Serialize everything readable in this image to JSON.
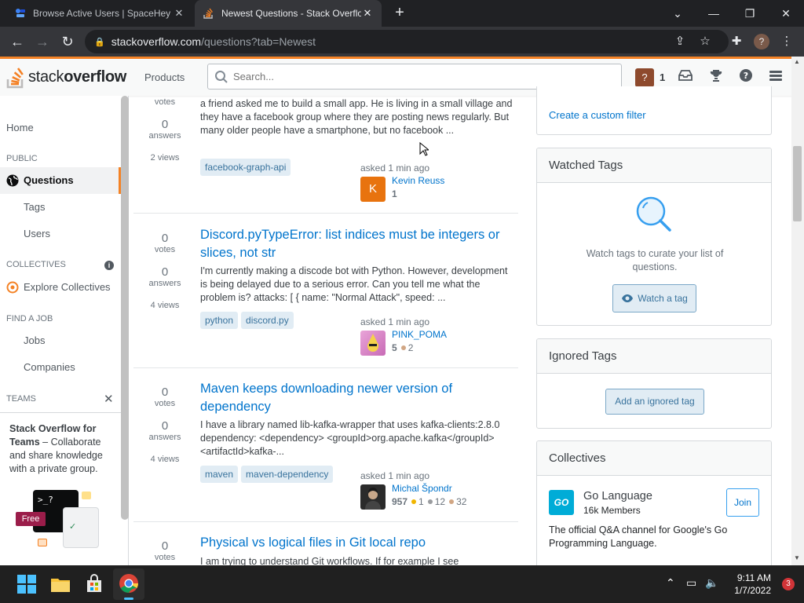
{
  "browser": {
    "tabs": [
      {
        "title": "Browse Active Users | SpaceHey",
        "active": false
      },
      {
        "title": "Newest Questions - Stack Overflow",
        "active": true
      }
    ],
    "url_host": "stackoverflow.com",
    "url_path": "/questions?tab=Newest",
    "profile_initial": "?"
  },
  "header": {
    "logo_stack": "stack",
    "logo_overflow": "overflow",
    "products": "Products",
    "search_placeholder": "Search...",
    "rep_count": "1",
    "avatar_initial": "?"
  },
  "sidebar": {
    "home": "Home",
    "public": "PUBLIC",
    "questions": "Questions",
    "tags": "Tags",
    "users": "Users",
    "collectives": "COLLECTIVES",
    "explore_collectives": "Explore Collectives",
    "find_a_job": "FIND A JOB",
    "jobs": "Jobs",
    "companies": "Companies",
    "teams": "TEAMS",
    "teams_title": "Stack Overflow for Teams",
    "teams_desc": " – Collaborate and share knowledge with a private group.",
    "free_badge": "Free"
  },
  "questions": [
    {
      "votes_label": "votes",
      "answers_num": "0",
      "answers_label": "answers",
      "views": "2 views",
      "excerpt": "a friend asked me to build a small app. He is living in a small village and they have a facebook group where they are posting news regularly. But many older people have a smartphone, but no facebook ...",
      "tags": [
        "facebook-graph-api"
      ],
      "asked": "asked 1 min ago",
      "user": "Kevin Reuss",
      "rep": "1",
      "avatar_letter": "K"
    },
    {
      "votes_num": "0",
      "votes_label": "votes",
      "answers_num": "0",
      "answers_label": "answers",
      "views": "4 views",
      "title": "Discord.pyTypeError: list indices must be integers or slices, not str",
      "excerpt": "I'm currently making a discode bot with Python. However, development is being delayed due to a serious error. Can you tell me what the problem is? attacks: [ { name: \"Normal Attack\", speed: ...",
      "tags": [
        "python",
        "discord.py"
      ],
      "asked": "asked 1 min ago",
      "user": "PINK_POMA",
      "rep": "5",
      "bronze": "2"
    },
    {
      "votes_num": "0",
      "votes_label": "votes",
      "answers_num": "0",
      "answers_label": "answers",
      "views": "4 views",
      "title": "Maven keeps downloading newer version of dependency",
      "excerpt": "I have a library named lib-kafka-wrapper that uses kafka-clients:2.8.0 dependency: <dependency> <groupId>org.apache.kafka</groupId> <artifactId>kafka-...",
      "tags": [
        "maven",
        "maven-dependency"
      ],
      "asked": "asked 1 min ago",
      "user": "Michal Špondr",
      "rep": "957",
      "gold": "1",
      "silver": "12",
      "bronze": "32"
    },
    {
      "votes_num": "0",
      "votes_label": "votes",
      "title": "Physical vs logical files in Git local repo",
      "excerpt": "I am trying to understand Git workflows. If for example I see"
    }
  ],
  "right": {
    "custom_filter": "Create a custom filter",
    "watched_title": "Watched Tags",
    "watched_desc": "Watch tags to curate your list of questions.",
    "watch_btn": "Watch a tag",
    "ignored_title": "Ignored Tags",
    "ignored_btn": "Add an ignored tag",
    "collectives_title": "Collectives",
    "go_name": "Go Language",
    "go_logo": "GO",
    "go_members": "16k Members",
    "join": "Join",
    "go_desc": "The official Q&A channel for Google's Go Programming Language."
  },
  "taskbar": {
    "time": "9:11 AM",
    "date": "1/7/2022",
    "notifications": "3"
  },
  "colors": {
    "accent": "#f48225",
    "link": "#0074cc",
    "tag_bg": "#e1ecf4",
    "tag_fg": "#39739d"
  }
}
